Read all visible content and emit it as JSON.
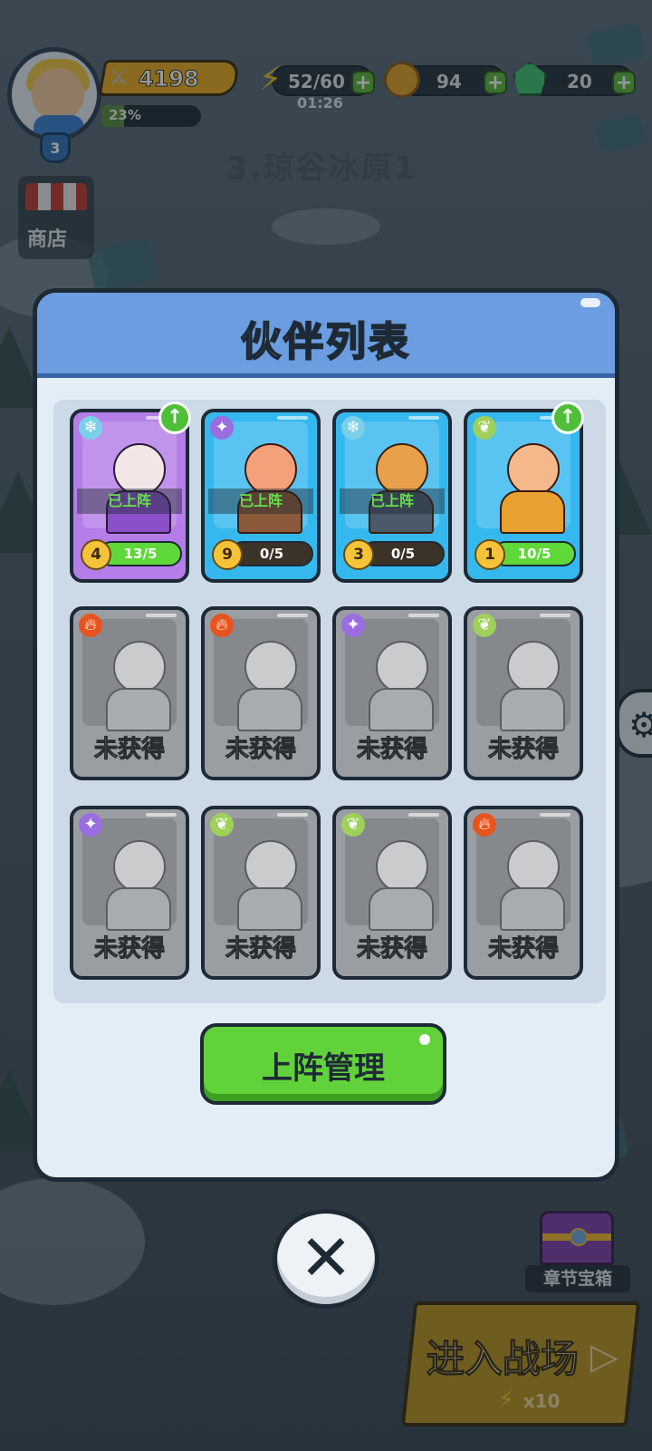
{
  "hud": {
    "player_level": "3",
    "power": "4198",
    "exp_percent": "23%",
    "exp_fraction": 0.23,
    "energy": "52/60",
    "energy_timer": "01:26",
    "coins": "94",
    "gems": "20",
    "stage_title": "3.琼谷冰原1",
    "shop_label": "商店"
  },
  "modal": {
    "title": "伙伴列表",
    "deploy_button_label": "上阵管理"
  },
  "partners": [
    {
      "element": "ice",
      "icon": "ice-crystal-icon",
      "status": "已上阵",
      "stars": "4",
      "progress": "13/5",
      "progress_fraction": 1.0,
      "upgradable": true,
      "color": "#b47de8"
    },
    {
      "element": "shadow",
      "icon": "shadow-crystal-icon",
      "status": "已上阵",
      "stars": "9",
      "progress": "0/5",
      "progress_fraction": 0.0,
      "upgradable": false,
      "color": "#35b8ee"
    },
    {
      "element": "ice",
      "icon": "ice-crystal-icon",
      "status": "已上阵",
      "stars": "3",
      "progress": "0/5",
      "progress_fraction": 0.0,
      "upgradable": false,
      "color": "#35b8ee"
    },
    {
      "element": "wind",
      "icon": "leaf-icon",
      "status": "",
      "stars": "1",
      "progress": "10/5",
      "progress_fraction": 1.0,
      "upgradable": true,
      "color": "#35b8ee"
    }
  ],
  "locked_partners": [
    {
      "element": "fire",
      "icon": "fire-icon",
      "label": "未获得"
    },
    {
      "element": "fire",
      "icon": "fire-icon",
      "label": "未获得"
    },
    {
      "element": "shadow",
      "icon": "shadow-crystal-icon",
      "label": "未获得"
    },
    {
      "element": "wind",
      "icon": "leaf-icon",
      "label": "未获得"
    },
    {
      "element": "shadow",
      "icon": "shadow-crystal-icon",
      "label": "未获得"
    },
    {
      "element": "wind",
      "icon": "leaf-icon",
      "label": "未获得"
    },
    {
      "element": "wind",
      "icon": "leaf-icon",
      "label": "未获得"
    },
    {
      "element": "fire",
      "icon": "fire-icon",
      "label": "未获得"
    }
  ],
  "bottom": {
    "chest_label": "章节宝箱",
    "battle_label": "进入战场",
    "battle_cost": "x10"
  },
  "colors": {
    "accent_green": "#62d23a",
    "modal_header": "#6b9de0",
    "progress_fill": "#5fd83a"
  }
}
